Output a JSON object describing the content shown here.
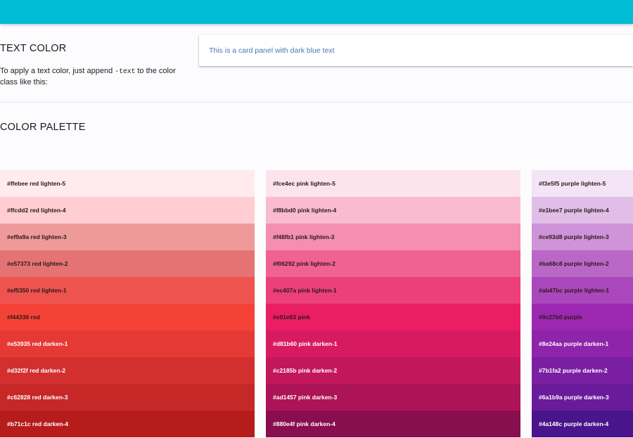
{
  "colors": {
    "topbar": "#00bcd4",
    "card_text": "#4a78b0",
    "dark_text": "#2b1a1a",
    "light_text": "#ffffff"
  },
  "intro": {
    "title": "TEXT COLOR",
    "text_before": "To apply a text color, just append ",
    "code": "-text",
    "text_after": " to the color class like this:"
  },
  "card": {
    "text": "This is a card panel with dark blue text"
  },
  "palette": {
    "title": "COLOR PALETTE",
    "columns": [
      {
        "name": "red",
        "swatches": [
          {
            "hex": "#ffebee",
            "label": "#ffebee red lighten-5",
            "dark": true
          },
          {
            "hex": "#ffcdd2",
            "label": "#ffcdd2 red lighten-4",
            "dark": true
          },
          {
            "hex": "#ef9a9a",
            "label": "#ef9a9a red lighten-3",
            "dark": true
          },
          {
            "hex": "#e57373",
            "label": "#e57373 red lighten-2",
            "dark": true
          },
          {
            "hex": "#ef5350",
            "label": "#ef5350 red lighten-1",
            "dark": true
          },
          {
            "hex": "#f44336",
            "label": "#f44336 red",
            "dark": true
          },
          {
            "hex": "#e53935",
            "label": "#e53935 red darken-1",
            "dark": false
          },
          {
            "hex": "#d32f2f",
            "label": "#d32f2f red darken-2",
            "dark": false
          },
          {
            "hex": "#c62828",
            "label": "#c62828 red darken-3",
            "dark": false
          },
          {
            "hex": "#b71c1c",
            "label": "#b71c1c red darken-4",
            "dark": false
          }
        ]
      },
      {
        "name": "pink",
        "swatches": [
          {
            "hex": "#fce4ec",
            "label": "#fce4ec pink lighten-5",
            "dark": true
          },
          {
            "hex": "#f8bbd0",
            "label": "#f8bbd0 pink lighten-4",
            "dark": true
          },
          {
            "hex": "#f48fb1",
            "label": "#f48fb1 pink lighten-3",
            "dark": true
          },
          {
            "hex": "#f06292",
            "label": "#f06292 pink lighten-2",
            "dark": true
          },
          {
            "hex": "#ec407a",
            "label": "#ec407a pink lighten-1",
            "dark": true
          },
          {
            "hex": "#e91e63",
            "label": "#e91e63 pink",
            "dark": true
          },
          {
            "hex": "#d81b60",
            "label": "#d81b60 pink darken-1",
            "dark": false
          },
          {
            "hex": "#c2185b",
            "label": "#c2185b pink darken-2",
            "dark": false
          },
          {
            "hex": "#ad1457",
            "label": "#ad1457 pink darken-3",
            "dark": false
          },
          {
            "hex": "#880e4f",
            "label": "#880e4f pink darken-4",
            "dark": false
          }
        ]
      },
      {
        "name": "purple",
        "swatches": [
          {
            "hex": "#f3e5f5",
            "label": "#f3e5f5 purple lighten-5",
            "dark": true
          },
          {
            "hex": "#e1bee7",
            "label": "#e1bee7 purple lighten-4",
            "dark": true
          },
          {
            "hex": "#ce93d8",
            "label": "#ce93d8 purple lighten-3",
            "dark": true
          },
          {
            "hex": "#ba68c8",
            "label": "#ba68c8 purple lighten-2",
            "dark": true
          },
          {
            "hex": "#ab47bc",
            "label": "#ab47bc purple lighten-1",
            "dark": true
          },
          {
            "hex": "#9c27b0",
            "label": "#9c27b0 purple",
            "dark": true
          },
          {
            "hex": "#8e24aa",
            "label": "#8e24aa purple darken-1",
            "dark": false
          },
          {
            "hex": "#7b1fa2",
            "label": "#7b1fa2 purple darken-2",
            "dark": false
          },
          {
            "hex": "#6a1b9a",
            "label": "#6a1b9a purple darken-3",
            "dark": false
          },
          {
            "hex": "#4a148c",
            "label": "#4a148c purple darken-4",
            "dark": false
          }
        ]
      }
    ]
  }
}
